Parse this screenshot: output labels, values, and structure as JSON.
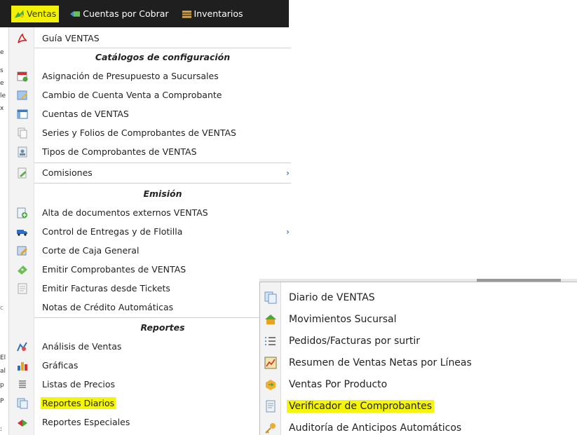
{
  "menubar": {
    "items": [
      {
        "label": "Ventas",
        "icon": "sales-icon",
        "active": true
      },
      {
        "label": "Cuentas por Cobrar",
        "icon": "receivables-icon",
        "active": false
      },
      {
        "label": "Inventarios",
        "icon": "inventory-icon",
        "active": false
      }
    ]
  },
  "menu": {
    "guia": "Guía VENTAS",
    "hdr_catalogos": "Catálogos de configuración",
    "asignacion": "Asignación de Presupuesto a Sucursales",
    "cambio": "Cambio de Cuenta Venta a Comprobante",
    "cuentas": "Cuentas de VENTAS",
    "series": "Series y Folios de Comprobantes de VENTAS",
    "tipos": "Tipos de Comprobantes de VENTAS",
    "comisiones": "Comisiones",
    "hdr_emision": "Emisión",
    "alta": "Alta de documentos externos VENTAS",
    "control": "Control de Entregas y de Flotilla",
    "corte": "Corte de Caja General",
    "emitir_comp": "Emitir Comprobantes de VENTAS",
    "emitir_fact": "Emitir Facturas desde Tickets",
    "notas": "Notas de Crédito Automáticas",
    "hdr_reportes": "Reportes",
    "analisis": "Análisis de Ventas",
    "graficas": "Gráficas",
    "listas": "Listas de Precios",
    "diarios": "Reportes Diarios",
    "especiales": "Reportes Especiales"
  },
  "submenu": {
    "items": [
      "Diario de VENTAS",
      "Movimientos Sucursal",
      "Pedidos/Facturas por surtir",
      "Resumen de Ventas Netas por Líneas",
      "Ventas Por Producto",
      "Verificador de Comprobantes",
      "Auditoría de Anticipos Automáticos"
    ]
  },
  "colors": {
    "highlight": "#f5f50a",
    "menubar": "#1f1f1f",
    "submenu_arrow": "#4b7ec7"
  }
}
